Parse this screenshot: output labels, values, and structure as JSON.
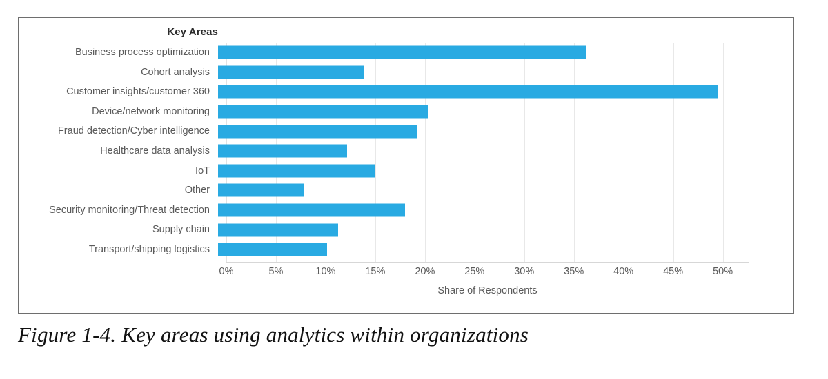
{
  "figure": {
    "caption": "Figure 1-4. Key areas using analytics within organizations"
  },
  "chart": {
    "legend_title": "Key Areas",
    "bar_color": "#29aae2",
    "grid_color": "#e8e8e8",
    "axis_line_color": "#d7d7d7",
    "label_color": "#5a5a5a",
    "frame_color": "#6e6e6e"
  },
  "chart_data": {
    "type": "bar",
    "orientation": "horizontal",
    "title": "Key Areas",
    "xlabel": "Share of Respondents",
    "ylabel": "Key Areas",
    "grid": true,
    "legend": false,
    "xlim": [
      0,
      52.6
    ],
    "xticks": [
      0,
      5,
      10,
      15,
      20,
      25,
      30,
      35,
      40,
      45,
      50
    ],
    "xtick_labels": [
      "0%",
      "5%",
      "10%",
      "15%",
      "20%",
      "25%",
      "30%",
      "35%",
      "40%",
      "45%",
      "50%"
    ],
    "categories": [
      "Business process optimization",
      "Cohort analysis",
      "Customer insights/customer 360",
      "Device/network monitoring",
      "Fraud detection/Cyber intelligence",
      "Healthcare data analysis",
      "IoT",
      "Other",
      "Security monitoring/Threat detection",
      "Supply chain",
      "Transport/shipping logistics"
    ],
    "values": [
      37.1,
      14.7,
      50.4,
      21.2,
      20.1,
      13.0,
      15.8,
      8.7,
      18.8,
      12.1,
      11.0
    ],
    "value_labels": [
      "37.1%",
      "14.7%",
      "50.4%",
      "21.2%",
      "20.1%",
      "13.0%",
      "15.8%",
      "8.7%",
      "18.8%",
      "12.1%",
      "11.0%"
    ]
  }
}
